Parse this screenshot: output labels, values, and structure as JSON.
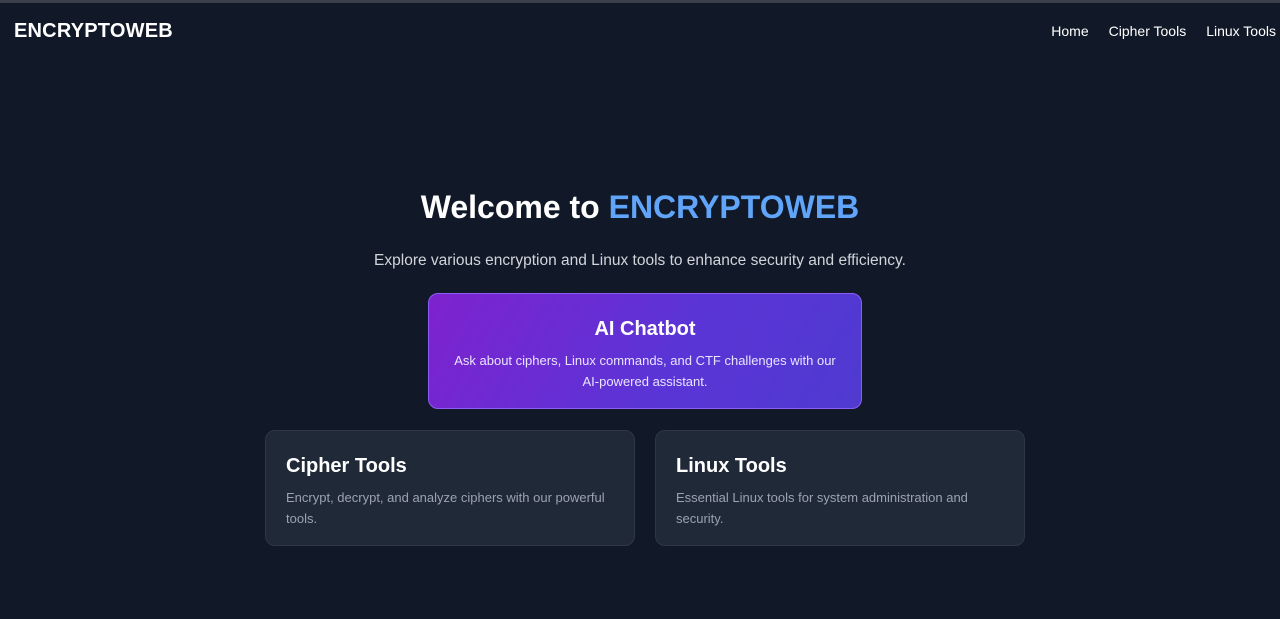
{
  "nav": {
    "brand": "ENCRYPTOWEB",
    "links": [
      "Home",
      "Cipher Tools",
      "Linux Tools"
    ]
  },
  "hero": {
    "title_prefix": "Welcome to ",
    "title_accent": "ENCRYPTOWEB",
    "subtitle": "Explore various encryption and Linux tools to enhance security and efficiency."
  },
  "chatbot": {
    "title": "AI Chatbot",
    "description": "Ask about ciphers, Linux commands, and CTF challenges with our AI-powered assistant."
  },
  "cards": [
    {
      "title": "Cipher Tools",
      "description": "Encrypt, decrypt, and analyze ciphers with our powerful tools."
    },
    {
      "title": "Linux Tools",
      "description": "Essential Linux tools for system administration and security."
    }
  ],
  "colors": {
    "background": "#111827",
    "accent": "#60a5fa",
    "card": "#1f2937",
    "chatbot_gradient_start": "#7e22ce",
    "chatbot_gradient_end": "#4f3ad0"
  }
}
